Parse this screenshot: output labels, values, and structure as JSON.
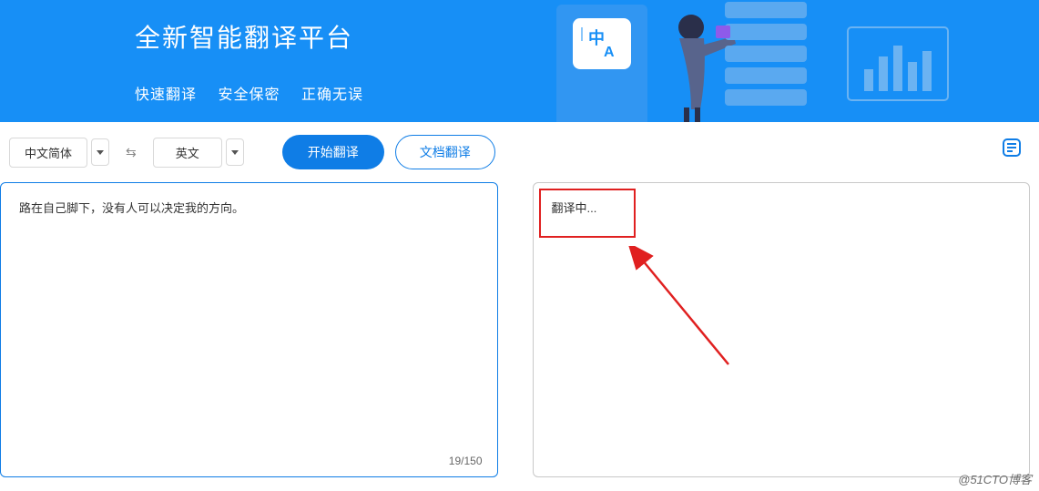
{
  "hero": {
    "title": "全新智能翻译平台",
    "feature1": "快速翻译",
    "feature2": "安全保密",
    "feature3": "正确无误"
  },
  "toolbar": {
    "source_lang": "中文简体",
    "target_lang": "英文",
    "translate_btn": "开始翻译",
    "document_btn": "文档翻译"
  },
  "panels": {
    "source_text": "路在自己脚下，没有人可以决定我的方向。",
    "char_count": "19/150",
    "target_text": "翻译中..."
  },
  "watermark": "@51CTO博客"
}
